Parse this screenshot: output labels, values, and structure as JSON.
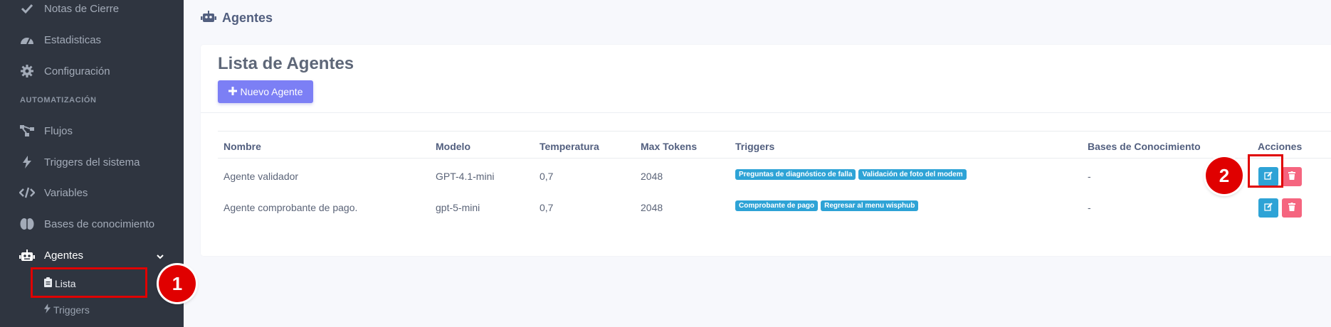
{
  "sidebar": {
    "items": [
      {
        "label": "Notas de Cierre",
        "icon": "check-icon"
      },
      {
        "label": "Estadisticas",
        "icon": "gauge-icon"
      },
      {
        "label": "Configuración",
        "icon": "gear-icon"
      },
      {
        "label": "Flujos",
        "icon": "flow-icon"
      },
      {
        "label": "Triggers del sistema",
        "icon": "bolt-icon"
      },
      {
        "label": "Variables",
        "icon": "code-icon"
      },
      {
        "label": "Bases de conocimiento",
        "icon": "brain-icon"
      },
      {
        "label": "Agentes",
        "icon": "robot-icon"
      }
    ],
    "section_label": "AUTOMATIZACIÓN",
    "sub_items": [
      {
        "label": "Lista",
        "icon": "clipboard-icon"
      },
      {
        "label": "Triggers",
        "icon": "bolt-icon"
      }
    ]
  },
  "header": {
    "title": "Agentes",
    "icon": "robot-icon"
  },
  "card": {
    "title": "Lista de Agentes",
    "new_button": "Nuevo Agente"
  },
  "table": {
    "columns": [
      "Nombre",
      "Modelo",
      "Temperatura",
      "Max Tokens",
      "Triggers",
      "Bases de Conocimiento",
      "Acciones"
    ],
    "rows": [
      {
        "nombre": "Agente validador",
        "modelo": "GPT-4.1-mini",
        "temperatura": "0,7",
        "max_tokens": "2048",
        "triggers": [
          "Preguntas de diagnóstico de falla",
          "Validación de foto del modem"
        ],
        "bases": "-"
      },
      {
        "nombre": "Agente comprobante de pago.",
        "modelo": "gpt-5-mini",
        "temperatura": "0,7",
        "max_tokens": "2048",
        "triggers": [
          "Comprobante de pago",
          "Regresar al menu wisphub"
        ],
        "bases": "-"
      }
    ]
  },
  "callouts": [
    "1",
    "2"
  ],
  "colors": {
    "sidebar_bg": "#2f3540",
    "primary": "#7c7ff5",
    "info": "#2ea3d6",
    "danger": "#f5657f",
    "callout": "#e00000"
  }
}
